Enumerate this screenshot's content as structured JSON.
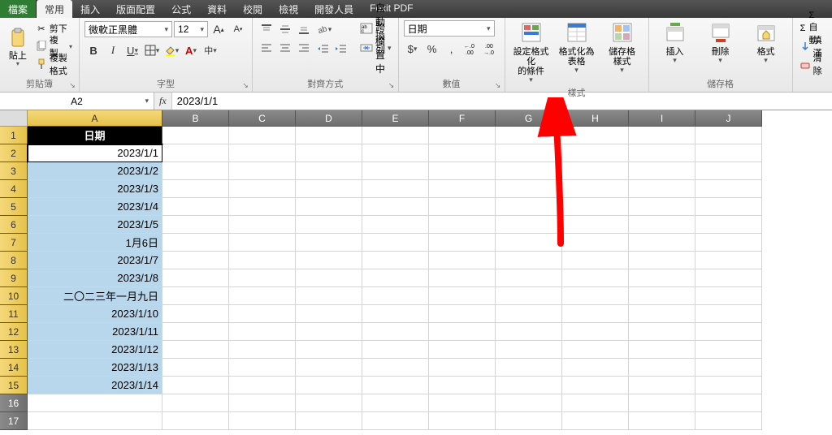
{
  "menu": {
    "file": "檔案",
    "tabs": [
      "常用",
      "插入",
      "版面配置",
      "公式",
      "資料",
      "校閱",
      "檢視",
      "開發人員",
      "Foxit PDF"
    ],
    "active": 0
  },
  "ribbon": {
    "clipboard": {
      "paste": "貼上",
      "cut": "剪下",
      "copy": "複製",
      "brush": "複製格式",
      "label": "剪貼簿"
    },
    "font": {
      "name": "微軟正黑體",
      "size": "12",
      "bold": "B",
      "italic": "I",
      "underline": "U",
      "zhuyin": "中",
      "label": "字型",
      "grow": "A",
      "shrink": "A"
    },
    "align": {
      "wrap": "自動換列",
      "merge": "跨欄置中",
      "label": "對齊方式"
    },
    "number": {
      "format": "日期",
      "currency": "$",
      "percent": "%",
      "comma": ",",
      "inc": "←.0\n.00",
      "dec": ".00\n→.0",
      "label": "數值"
    },
    "styles": {
      "cond": "設定格式化\n的條件",
      "table": "格式化為\n表格",
      "cell": "儲存格\n樣式",
      "label": "樣式"
    },
    "cells": {
      "insert": "插入",
      "delete": "刪除",
      "format": "格式",
      "label": "儲存格"
    },
    "editing": {
      "sum": "Σ 自動",
      "fill": "填滿",
      "clear": "清除"
    }
  },
  "formula_bar": {
    "cell_ref": "A2",
    "fx": "fx",
    "formula": "2023/1/1"
  },
  "grid": {
    "columns": [
      "A",
      "B",
      "C",
      "D",
      "E",
      "F",
      "G",
      "H",
      "I",
      "J"
    ],
    "col_widths": {
      "A": 166,
      "other": 82
    },
    "rows": [
      "1",
      "2",
      "3",
      "4",
      "5",
      "6",
      "7",
      "8",
      "9",
      "10",
      "11",
      "12",
      "13",
      "14",
      "15",
      "16",
      "17"
    ],
    "header_label": "日期",
    "active_cell": "A2",
    "data_A": [
      "日期",
      "2023/1/1",
      "2023/1/2",
      "2023/1/3",
      "2023/1/4",
      "2023/1/5",
      "1月6日",
      "2023/1/7",
      "2023/1/8",
      "二〇二三年一月九日",
      "2023/1/10",
      "2023/1/11",
      "2023/1/12",
      "2023/1/13",
      "2023/1/14"
    ],
    "highlight_rows": [
      3,
      4,
      5,
      6,
      7,
      8,
      9,
      10,
      11,
      12,
      13,
      14,
      15
    ]
  }
}
